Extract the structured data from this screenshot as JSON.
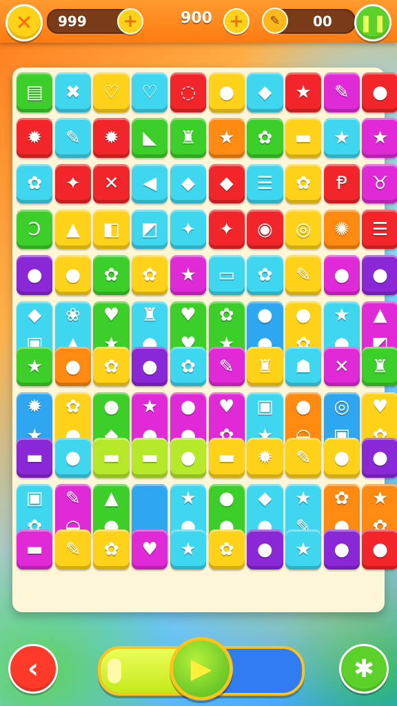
{
  "header": {
    "close_icon": "✕",
    "coins": "999",
    "score": "900",
    "hints": "00",
    "plus_icon": "+",
    "pause_icon": "❚❚",
    "pencil_icon": "✎"
  },
  "footer": {
    "back_icon": "‹",
    "play_icon": "▶",
    "puzzle_icon": "✱",
    "progress": 0.47
  },
  "colors": {
    "green": "#3ccf2a",
    "blue": "#2fa6f0",
    "yellow": "#ffd21a",
    "red": "#f2262a",
    "orange": "#ff8a12",
    "purple": "#8a28d8",
    "magenta": "#e02ad8",
    "cyan": "#3fd6f0",
    "lime": "#b6e82a",
    "lightblue": "#6fd0ff"
  },
  "board": {
    "rows": [
      [
        [
          "green",
          "▤"
        ],
        [
          "cyan",
          "✖"
        ],
        [
          "yellow",
          "♡"
        ],
        [
          "cyan",
          "♡"
        ],
        [
          "red",
          "◌"
        ],
        [
          "yellow",
          "●"
        ],
        [
          "cyan",
          "◆"
        ],
        [
          "red",
          "★"
        ],
        [
          "magenta",
          "✎"
        ],
        [
          "red",
          "●"
        ]
      ],
      [
        [
          "red",
          "✹"
        ],
        [
          "cyan",
          "✎"
        ],
        [
          "red",
          "✹"
        ],
        [
          "green",
          "◣"
        ],
        [
          "green",
          "♜"
        ],
        [
          "orange",
          "★"
        ],
        [
          "green",
          "✿"
        ],
        [
          "yellow",
          "▬"
        ],
        [
          "cyan",
          "★"
        ],
        [
          "magenta",
          "★"
        ]
      ],
      [
        [
          "cyan",
          "✿"
        ],
        [
          "red",
          "✦"
        ],
        [
          "red",
          "✕"
        ],
        [
          "cyan",
          "◀"
        ],
        [
          "cyan",
          "◆"
        ],
        [
          "red",
          "◆"
        ],
        [
          "cyan",
          "☰"
        ],
        [
          "yellow",
          "✿"
        ],
        [
          "red",
          "Ᵽ"
        ],
        [
          "magenta",
          "♉"
        ]
      ],
      [
        [
          "green",
          "Ɔ"
        ],
        [
          "yellow",
          "▲"
        ],
        [
          "yellow",
          "◧"
        ],
        [
          "cyan",
          "◩"
        ],
        [
          "cyan",
          "✦"
        ],
        [
          "red",
          "✦"
        ],
        [
          "red",
          "◉"
        ],
        [
          "yellow",
          "◎"
        ],
        [
          "orange",
          "✺"
        ],
        [
          "red",
          "☰"
        ]
      ],
      [
        [
          "purple",
          "●"
        ],
        [
          "yellow",
          "●"
        ],
        [
          "green",
          "✿"
        ],
        [
          "yellow",
          "✿"
        ],
        [
          "magenta",
          "★"
        ],
        [
          "cyan",
          "▭"
        ],
        [
          "cyan",
          "✿"
        ],
        [
          "yellow",
          "✎"
        ],
        [
          "magenta",
          "●"
        ],
        [
          "purple",
          "●"
        ]
      ],
      [
        [
          "cyan",
          "◆ ▣"
        ],
        [
          "cyan",
          "❀ ▲"
        ],
        [
          "green",
          "♥ ★"
        ],
        [
          "cyan",
          "♜ ●"
        ],
        [
          "green",
          "♥ ♥"
        ],
        [
          "green",
          "✿ ★"
        ],
        [
          "blue",
          "● ●"
        ],
        [
          "yellow",
          "● ✿"
        ],
        [
          "cyan",
          "★ ●"
        ],
        [
          "magenta",
          "▲ ◩"
        ]
      ],
      [
        [
          "green",
          "★"
        ],
        [
          "orange",
          "●"
        ],
        [
          "yellow",
          "✿"
        ],
        [
          "purple",
          "●"
        ],
        [
          "cyan",
          "✿"
        ],
        [
          "magenta",
          "✎"
        ],
        [
          "yellow",
          "♜"
        ],
        [
          "cyan",
          "☗"
        ],
        [
          "magenta",
          "✕"
        ],
        [
          "green",
          "♜"
        ]
      ],
      [
        [
          "blue",
          "✹ ★"
        ],
        [
          "yellow",
          "✿ ●"
        ],
        [
          "green",
          "● ◆"
        ],
        [
          "magenta",
          "★ ●"
        ],
        [
          "magenta",
          "● ●"
        ],
        [
          "magenta",
          "♥ ✿"
        ],
        [
          "cyan",
          "▣ ★"
        ],
        [
          "orange",
          "● ◒"
        ],
        [
          "blue",
          "◎ ▣"
        ],
        [
          "yellow",
          "♥ ✿"
        ]
      ],
      [
        [
          "purple",
          "▬"
        ],
        [
          "cyan",
          "●"
        ],
        [
          "lime",
          "▬"
        ],
        [
          "lime",
          "▬"
        ],
        [
          "lime",
          "●"
        ],
        [
          "yellow",
          "▬"
        ],
        [
          "yellow",
          "✹"
        ],
        [
          "yellow",
          "✎"
        ],
        [
          "yellow",
          "●"
        ],
        [
          "purple",
          "●"
        ]
      ],
      [
        [
          "cyan",
          "▣ ✿"
        ],
        [
          "magenta",
          "✎ ◒"
        ],
        [
          "green",
          "▲ ●"
        ],
        [
          "blue",
          ""
        ],
        [
          "cyan",
          "★ ●"
        ],
        [
          "green",
          "● ●"
        ],
        [
          "cyan",
          "◆ ●"
        ],
        [
          "cyan",
          "★ ✎"
        ],
        [
          "orange",
          "✿ ●"
        ],
        [
          "orange",
          "★ ✿"
        ]
      ],
      [
        [
          "magenta",
          "▬"
        ],
        [
          "yellow",
          "✎"
        ],
        [
          "yellow",
          "✿"
        ],
        [
          "magenta",
          "♥"
        ],
        [
          "cyan",
          "★"
        ],
        [
          "yellow",
          "✿"
        ],
        [
          "purple",
          "●"
        ],
        [
          "cyan",
          "★"
        ],
        [
          "purple",
          "●"
        ],
        [
          "red",
          "●"
        ]
      ]
    ]
  }
}
